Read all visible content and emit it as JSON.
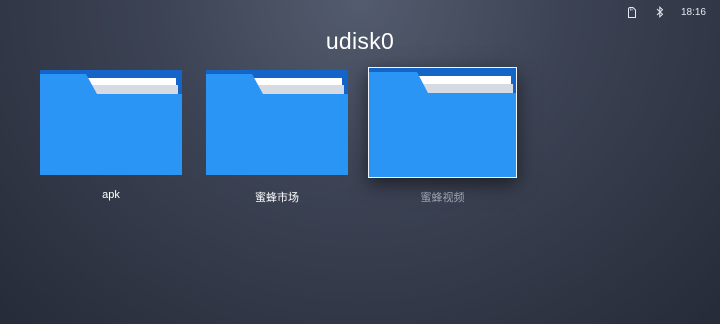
{
  "status_bar": {
    "time": "18:16",
    "icons": [
      "sd-card-icon",
      "bluetooth-icon"
    ]
  },
  "page": {
    "title": "udisk0"
  },
  "folders": [
    {
      "name": "apk",
      "selected": false
    },
    {
      "name": "蜜蜂市场",
      "selected": false
    },
    {
      "name": "蜜蜂视频",
      "selected": true
    }
  ],
  "colors": {
    "folder_front": "#2b95f6",
    "folder_back": "#1565c9",
    "paper": "#ffffff",
    "paper_shadow": "#d6dae2",
    "selection_border": "#f2f4f8"
  }
}
